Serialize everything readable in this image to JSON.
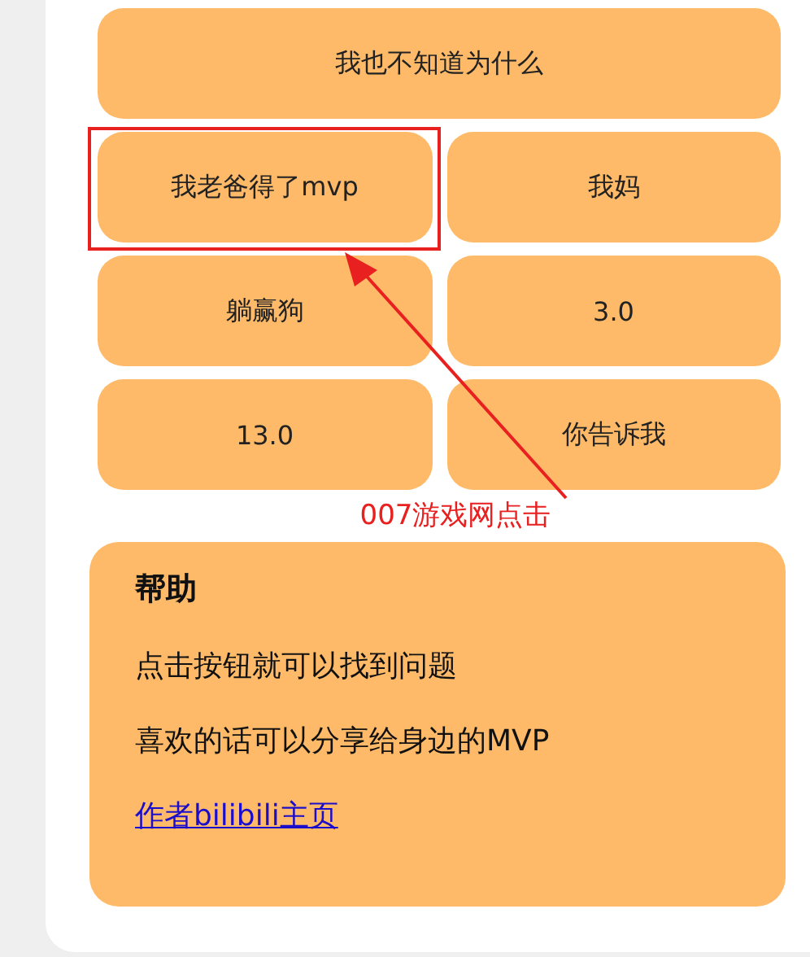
{
  "buttons": [
    {
      "label": "我也不知道为什么",
      "wide": true,
      "highlighted": false
    },
    {
      "label": "我老爸得了mvp",
      "wide": false,
      "highlighted": true
    },
    {
      "label": "我妈",
      "wide": false,
      "highlighted": false
    },
    {
      "label": "躺赢狗",
      "wide": false,
      "highlighted": false
    },
    {
      "label": "3.0",
      "wide": false,
      "highlighted": false
    },
    {
      "label": "13.0",
      "wide": false,
      "highlighted": false
    },
    {
      "label": "你告诉我",
      "wide": false,
      "highlighted": false
    }
  ],
  "annotation": {
    "label": "007游戏网点击"
  },
  "help": {
    "title": "帮助",
    "lines": [
      "点击按钮就可以找到问题",
      "喜欢的话可以分享给身边的MVP"
    ],
    "link": "作者bilibili主页"
  }
}
